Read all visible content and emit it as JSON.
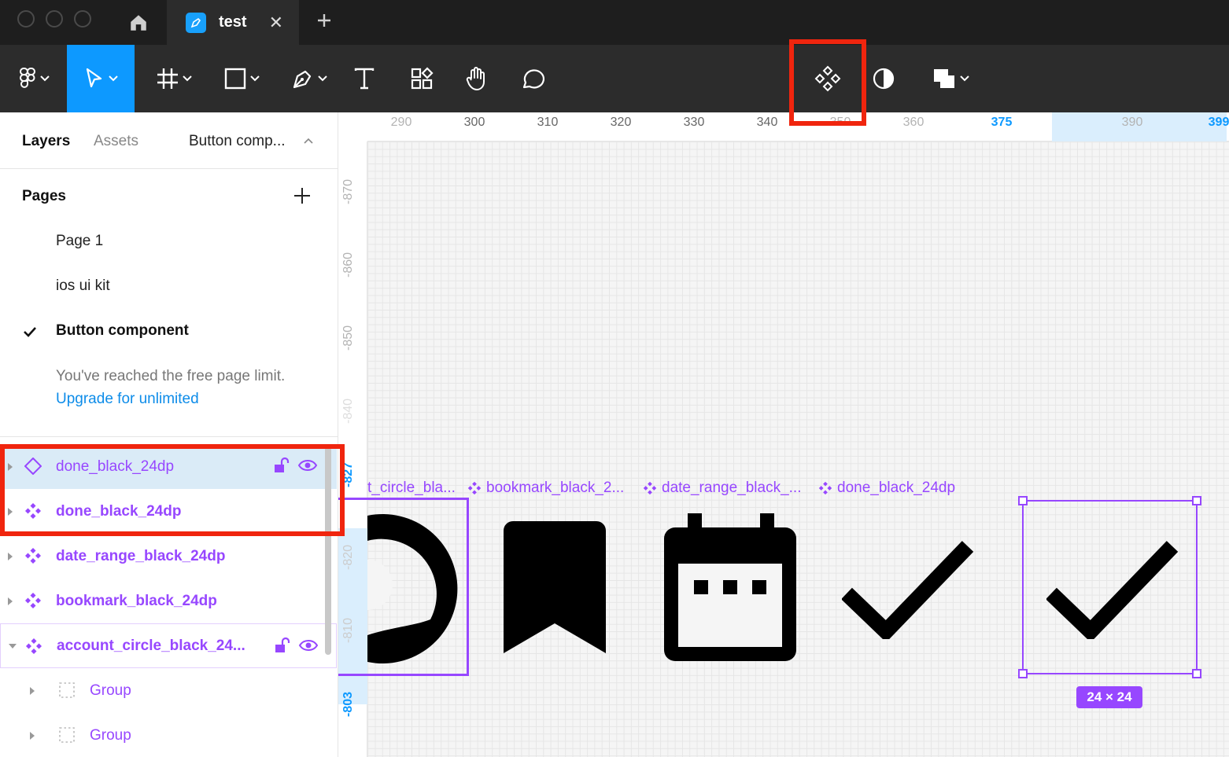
{
  "titlebar": {
    "file_tab_name": "test",
    "close_symbol": "✕",
    "new_tab_symbol": "+"
  },
  "toolbar": {
    "tools": [
      "figma-menu",
      "move-tool",
      "frame-tool",
      "shape-tool",
      "pen-tool",
      "text-tool",
      "resources-tool",
      "hand-tool",
      "comment-tool",
      "create-component",
      "mask",
      "boolean-ops"
    ],
    "active_tool": "move-tool"
  },
  "left_panel": {
    "tabs": {
      "layers": "Layers",
      "assets": "Assets",
      "page_selector": "Button comp..."
    },
    "pages_header": "Pages",
    "pages": [
      "Page 1",
      "ios ui kit",
      "Button component"
    ],
    "current_page": "Button component",
    "limit_text": "You've reached the free page limit.",
    "upgrade_link": "Upgrade for unlimited",
    "layers": [
      {
        "name": "done_black_24dp",
        "icon": "component-instance-icon",
        "bold": false,
        "selected": true
      },
      {
        "name": "done_black_24dp",
        "icon": "component-icon",
        "bold": true
      },
      {
        "name": "date_range_black_24dp",
        "icon": "component-icon",
        "bold": true
      },
      {
        "name": "bookmark_black_24dp",
        "icon": "component-icon",
        "bold": true
      },
      {
        "name": "account_circle_black_24...",
        "icon": "component-icon",
        "bold": true,
        "expanded": true
      },
      {
        "name": "Group",
        "icon": "group-icon",
        "bold": false
      },
      {
        "name": "Group",
        "icon": "group-icon",
        "bold": false
      }
    ]
  },
  "canvas": {
    "h_ruler": [
      "290",
      "300",
      "310",
      "320",
      "330",
      "340",
      "350",
      "360",
      "375",
      "390",
      "399"
    ],
    "h_ruler_selected": [
      "375",
      "399"
    ],
    "v_ruler": [
      "-870",
      "-860",
      "-850",
      "-840",
      "-827",
      "-820",
      "-810",
      "-803"
    ],
    "v_ruler_selected": [
      "-827",
      "-803"
    ],
    "frame_labels": [
      "t_circle_bla...",
      "bookmark_black_2...",
      "date_range_black_...",
      "done_black_24dp"
    ],
    "selection_size": "24 × 24"
  },
  "colors": {
    "accent_blue": "#0d99ff",
    "component_purple": "#9747ff",
    "highlight_red": "#f0250e"
  }
}
